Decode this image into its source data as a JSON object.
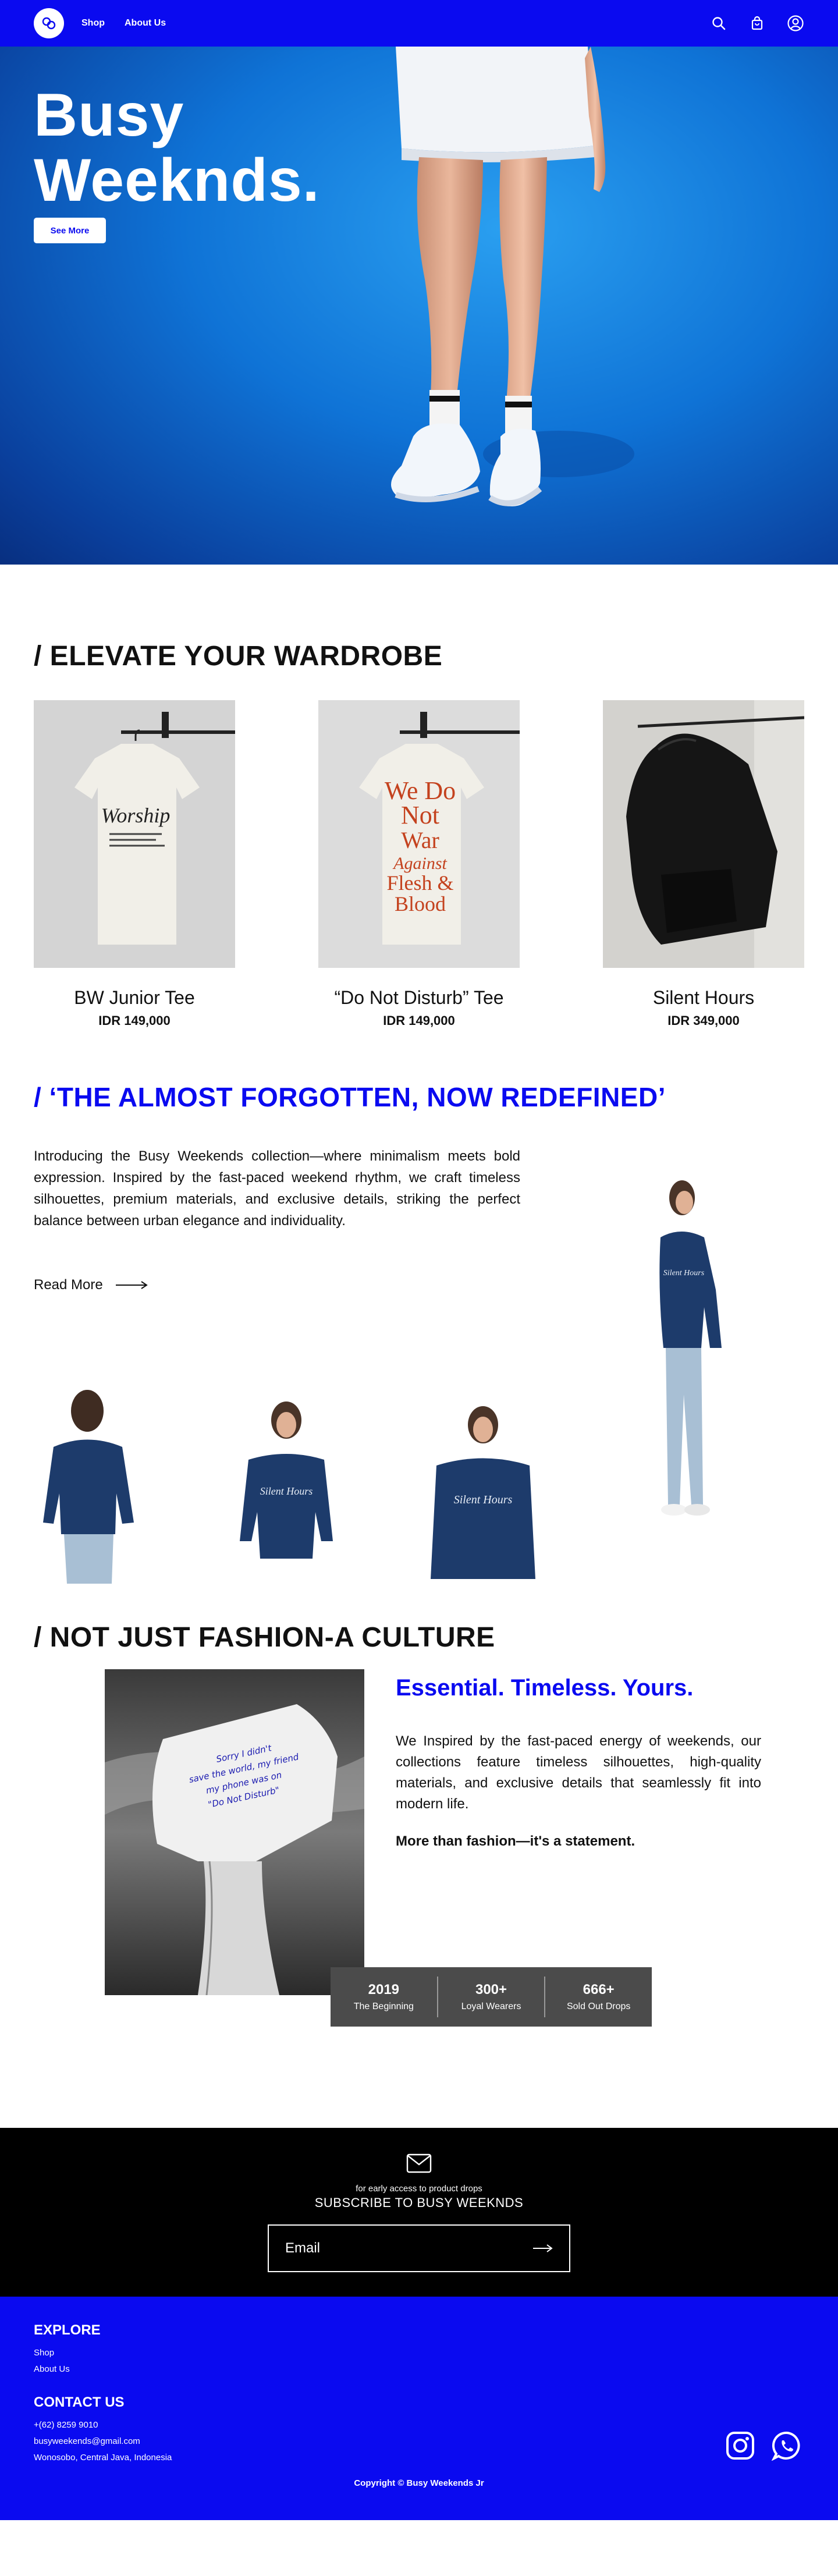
{
  "nav": {
    "links": [
      "Shop",
      "About Us"
    ],
    "icons": [
      "search-icon",
      "shopping-bag-icon",
      "user-icon"
    ],
    "brand_color": "#0a0af0"
  },
  "hero": {
    "title_line1": "Busy",
    "title_line2": "Weeknds.",
    "button_label": "See More"
  },
  "wardrobe": {
    "title": "/ ELEVATE YOUR WARDROBE",
    "products": [
      {
        "name": "BW Junior Tee",
        "price": "IDR 149,000"
      },
      {
        "name": "“Do Not Disturb” Tee",
        "price": "IDR 149,000"
      },
      {
        "name": "Silent Hours",
        "price": "IDR 349,000"
      }
    ]
  },
  "redefined": {
    "title": "/ ‘THE ALMOST FORGOTTEN, NOW REDEFINED’",
    "intro": "Introducing the Busy Weekends collection—where minimalism meets bold expression. Inspired by the fast-paced weekend rhythm, we craft timeless silhouettes, premium materials, and exclusive details, striking the perfect balance between urban elegance and individuality.",
    "read_more": "Read More"
  },
  "culture": {
    "title": "/ NOT JUST FASHION-A CULTURE",
    "essential_title": "Essential. Timeless. Yours.",
    "essential_text": "We Inspired by the fast-paced energy of weekends, our collections feature timeless silhouettes, high-quality materials, and exclusive details that seamlessly fit into modern life.",
    "statement": "More than fashion—it's a statement.",
    "stats": [
      {
        "value": "2019",
        "label": "The Beginning"
      },
      {
        "value": "300+",
        "label": "Loyal Wearers"
      },
      {
        "value": "666+",
        "label": "Sold Out Drops"
      }
    ]
  },
  "subscribe": {
    "small": "for early access to product drops",
    "title": "SUBSCRIBE TO BUSY WEEKNDS",
    "placeholder": "Email"
  },
  "footer": {
    "explore_title": "EXPLORE",
    "explore_links": [
      "Shop",
      "About Us"
    ],
    "contact_title": "CONTACT US",
    "phone": "+(62) 8259 9010",
    "email": "busyweekends@gmail.com",
    "address": "Wonosobo, Central Java, Indonesia",
    "copyright": "Copyright © Busy Weekends Jr",
    "social_icons": [
      "instagram-icon",
      "whatsapp-icon"
    ]
  }
}
